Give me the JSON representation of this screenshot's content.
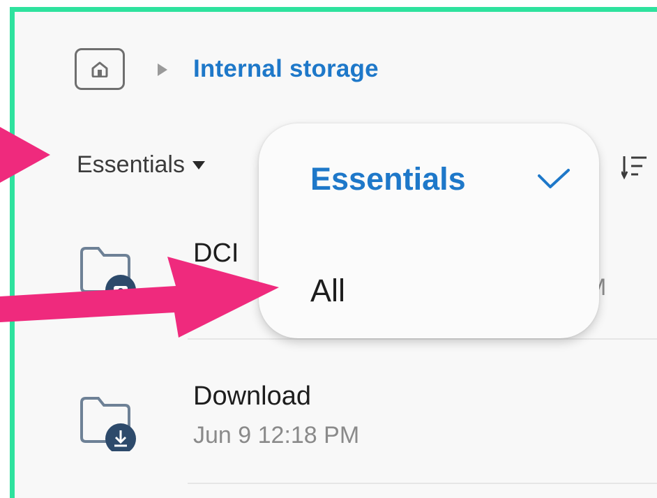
{
  "breadcrumb": {
    "home_icon": "home-icon",
    "separator_icon": "triangle-right-icon",
    "current": "Internal storage"
  },
  "filter": {
    "label": "Essentials",
    "caret_icon": "triangle-down-icon",
    "sort_icon": "sort-icon"
  },
  "dropdown": {
    "options": [
      {
        "label": "Essentials",
        "selected": true,
        "icon": "check-icon"
      },
      {
        "label": "All",
        "selected": false
      }
    ]
  },
  "files": [
    {
      "name": "DCI",
      "date": "M",
      "icon": "camera-folder-icon"
    },
    {
      "name": "Download",
      "date": "Jun 9 12:18 PM",
      "icon": "download-folder-icon"
    }
  ],
  "colors": {
    "accent": "#1e78c9",
    "frame": "#2ee29e",
    "annotation_arrow": "#ef2a7d",
    "folder_badge": "#2d4a6b"
  }
}
